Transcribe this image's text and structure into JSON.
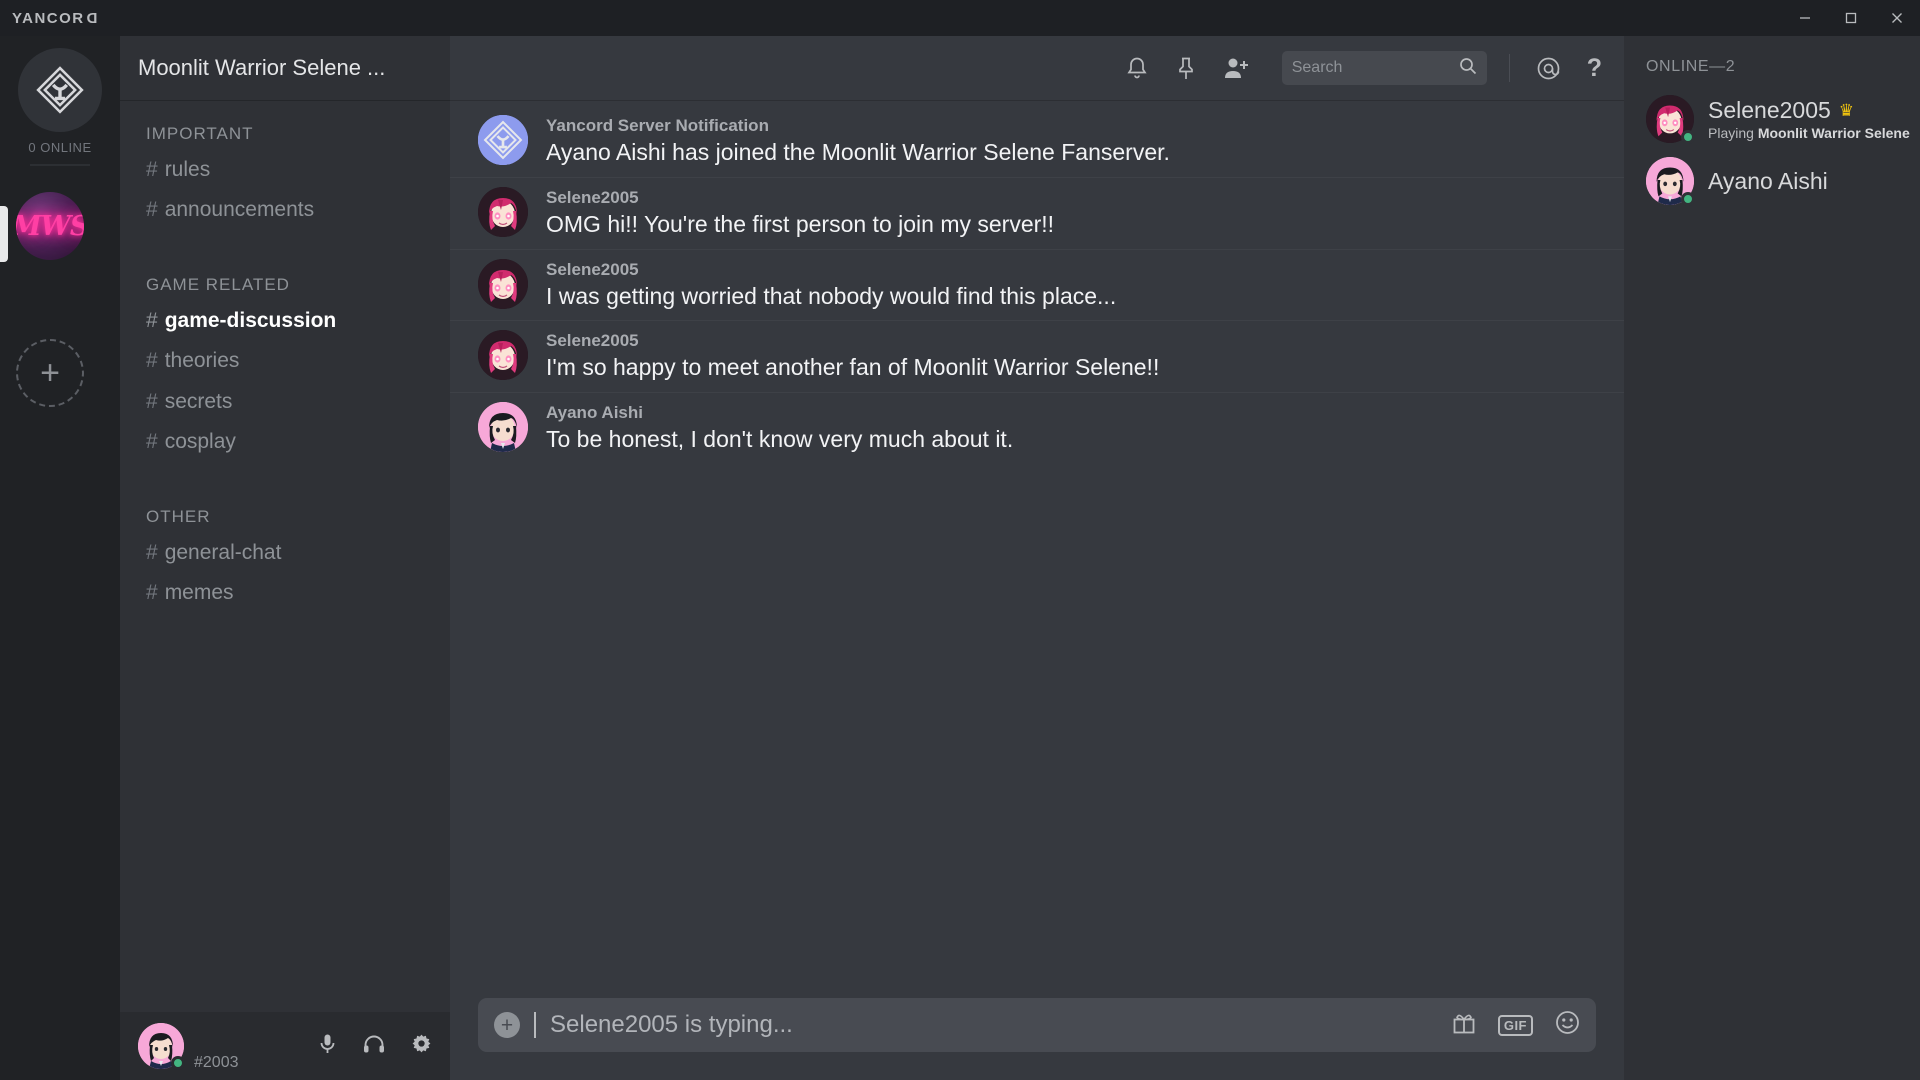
{
  "titlebar": {
    "brand": "YANCOR",
    "brand_last": "D",
    "minimize": "minimize-button",
    "maximize": "maximize-button",
    "close": "close-button"
  },
  "rail": {
    "home_label": "home-server",
    "online_count": "0 ONLINE",
    "servers": [
      {
        "initials": "MWS",
        "name": "Moonlit Warrior Selene Fanserver",
        "active": true
      }
    ],
    "add_label": "+"
  },
  "channel_panel": {
    "server_name": "Moonlit Warrior Selene ...",
    "categories": [
      {
        "label": "IMPORTANT",
        "channels": [
          {
            "hash": "#",
            "name": "rules",
            "active": false
          },
          {
            "hash": "#",
            "name": "announcements",
            "active": false
          }
        ]
      },
      {
        "label": "GAME RELATED",
        "channels": [
          {
            "hash": "#",
            "name": "game-discussion",
            "active": true
          },
          {
            "hash": "#",
            "name": "theories",
            "active": false
          },
          {
            "hash": "#",
            "name": "secrets",
            "active": false
          },
          {
            "hash": "#",
            "name": "cosplay",
            "active": false
          }
        ]
      },
      {
        "label": "OTHER",
        "channels": [
          {
            "hash": "#",
            "name": "general-chat",
            "active": false
          },
          {
            "hash": "#",
            "name": "memes",
            "active": false
          }
        ]
      }
    ]
  },
  "user_panel": {
    "discriminator": "#2003",
    "status": "online",
    "icons": [
      "microphone-icon",
      "headphones-icon",
      "settings-gear-icon"
    ]
  },
  "chat_header": {
    "icons": [
      "bell-icon",
      "pin-icon",
      "add-member-icon"
    ],
    "search": {
      "placeholder": "Search",
      "value": ""
    },
    "right_icons": [
      "mention-icon",
      "help-icon"
    ]
  },
  "messages": [
    {
      "author": "Yancord Server Notification",
      "text": "Ayano Aishi has joined the Moonlit Warrior Selene Fanserver.",
      "avatar": "yancord-logo"
    },
    {
      "author": "Selene2005",
      "text": "OMG hi!! You're the first person to join my server!!",
      "avatar": "selene-avatar"
    },
    {
      "author": "Selene2005",
      "text": "I was getting worried that nobody would find this place...",
      "avatar": "selene-avatar"
    },
    {
      "author": "Selene2005",
      "text": "I'm so happy to meet another fan of Moonlit Warrior Selene!!",
      "avatar": "selene-avatar"
    },
    {
      "author": "Ayano Aishi",
      "text": "To be honest, I don't know very much about it.",
      "avatar": "ayano-avatar"
    }
  ],
  "composer": {
    "add_label": "+",
    "placeholder": "Selene2005 is typing...",
    "value": "",
    "gif_label": "GIF",
    "icons": [
      "gift-icon",
      "gif-icon",
      "emoji-icon"
    ]
  },
  "members": {
    "title": "ONLINE—2",
    "list": [
      {
        "name": "Selene2005",
        "crown": "♛",
        "status_prefix": "Playing ",
        "status_game": "Moonlit Warrior Selene",
        "presence": "online"
      },
      {
        "name": "Ayano Aishi",
        "crown": "",
        "status_prefix": "",
        "status_game": "",
        "presence": "online"
      }
    ]
  },
  "colors": {
    "accent_pink": "#ff3fa4",
    "online_green": "#43b581",
    "crown_gold": "#f1c40f",
    "bg_chat": "#36393f",
    "bg_sidebar": "#2f3136",
    "bg_rail": "#202225"
  }
}
